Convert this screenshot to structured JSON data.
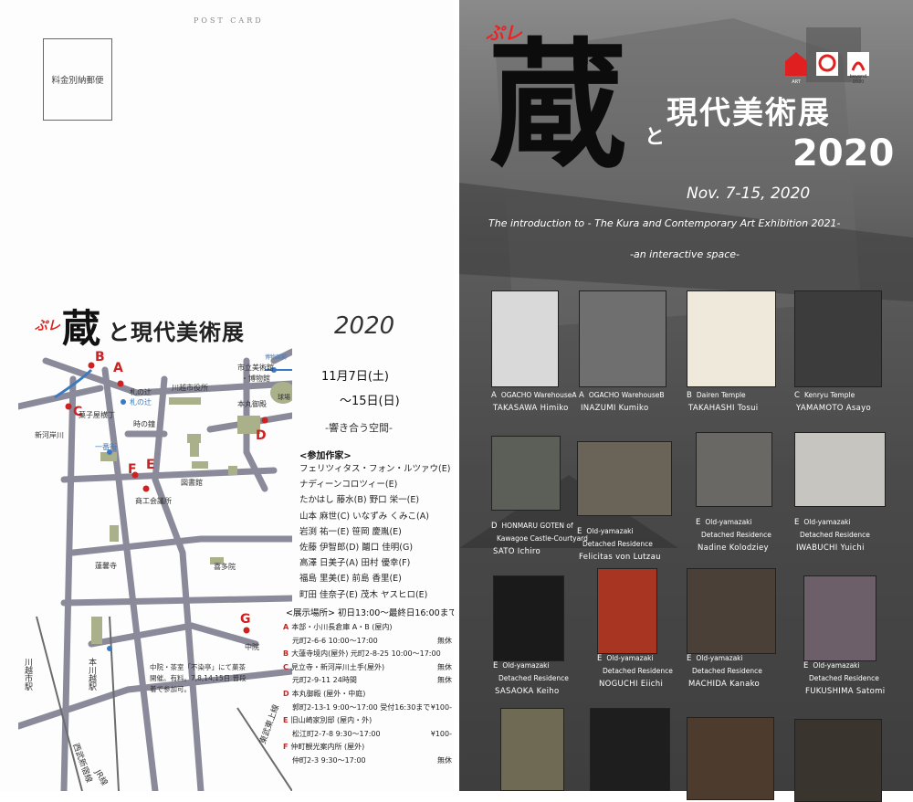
{
  "left_card": {
    "header": "POST CARD",
    "stamp": "料金別納郵便",
    "title_pre": "ぷレ",
    "title_kura": "蔵",
    "title_rest": "と現代美術展",
    "title_year": "2020",
    "date_start": "11月7日(土)",
    "date_end": "〜15日(日)",
    "subtitle": "-響き合う空間-",
    "artists_heading": "<参加作家>",
    "artists": [
      "フェリツィタス・フォン・ルツァウ(E)",
      "ナディーンコロツィー(E)",
      "たかはし 藤水(B)  野口 栄一(E)",
      "山本 麻世(C)  いなずみ くみこ(A)",
      "岩渕 祐一(E)  笹岡 慶胤(E)",
      "佐藤 伊智郎(D)  鬮口 佳明(G)",
      "高澤 日美子(A)  田村 優幸(F)",
      "福島 里美(E)  前島 香里(E)",
      "町田 佳奈子(E)  茂木 ヤスヒロ(E)"
    ],
    "venues_heading": "<展示場所>  初日13:00〜最終日16:00まで",
    "venues": [
      {
        "letter": "A",
        "text": "本部・小川長倉庫 A・B (屋内)",
        "right": ""
      },
      {
        "letter": "",
        "text": "元町2-6-6  10:00〜17:00",
        "right": "無休"
      },
      {
        "letter": "B",
        "text": "大蓮寺境内(屋外) 元町2-8-25 10:00〜17:00",
        "right": "無休"
      },
      {
        "letter": "C",
        "text": "見立寺・新河岸川土手(屋外)",
        "right": ""
      },
      {
        "letter": "",
        "text": "元町2-9-11 24時間",
        "right": "無休"
      },
      {
        "letter": "D",
        "text": "本丸御殿 (屋外・中庭)",
        "right": ""
      },
      {
        "letter": "",
        "text": "郭町2-13-1 9:00〜17:00 受付16:30まで",
        "right": "¥100-"
      },
      {
        "letter": "E",
        "text": "旧山崎家別邸 (屋内・外)",
        "right": ""
      },
      {
        "letter": "",
        "text": "松江町2-7-8  9:30〜17:00",
        "right": "¥100-"
      },
      {
        "letter": "F",
        "text": "仲町観光案内所 (屋外)",
        "right": ""
      },
      {
        "letter": "",
        "text": "仲町2-3  9:30〜17:00",
        "right": "無休"
      }
    ],
    "map_labels": {
      "a": "A",
      "b": "B",
      "c": "C",
      "d": "D",
      "e": "E",
      "f": "F",
      "g": "G",
      "fudanotsuji": "札の辻",
      "fudanotsuji2": "札の辻",
      "cityhall": "川越市役所",
      "museum": "市立美術館",
      "museum2": "・博物館",
      "honmaru": "本丸御殿",
      "kashiya": "菓子屋横丁",
      "tokinokane": "時の鐘",
      "shingashi": "新河岸川",
      "ichibangai": "一番街",
      "library": "図書館",
      "shoko": "商工会議所",
      "renjaku": "蓮馨寺",
      "kitain": "喜多院",
      "chuin": "中院",
      "hon_kawagoe": "本川越駅",
      "kawagoe_sta": "川越市駅",
      "seibu": "西武新宿線",
      "tobu": "東武東上線",
      "jr": "JR線",
      "kyujo": "球場",
      "museum_sm": "博物館前"
    },
    "notice": "中院・茶室「不染亭」にて菓茶開催。有料。7,8,14,15日  普段着で参加可。"
  },
  "right_card": {
    "pre": "ぷレ",
    "kura": "蔵",
    "to": "と",
    "main": "現代美術展",
    "year": "2020",
    "dates": "Nov. 7-15, 2020",
    "intro": "The introduction to - The Kura and Contemporary  Art  Exhibition 2021-",
    "interactive": "-an interactive space-",
    "logos": [
      {
        "icon": "house-art-icon",
        "label": "ART"
      },
      {
        "icon": "p-logo-icon",
        "label": ""
      },
      {
        "icon": "beyond-2020-icon",
        "label": "beyond 2020"
      }
    ],
    "works": [
      {
        "letter": "A",
        "venue": "OGACHO WarehouseA",
        "detail": "",
        "name": "TAKASAWA Himiko",
        "color": "#d9d9d9"
      },
      {
        "letter": "A",
        "venue": "OGACHO WarehouseB",
        "detail": "",
        "name": "INAZUMI Kumiko",
        "color": "#6f6f6f"
      },
      {
        "letter": "B",
        "venue": "Dairen Temple",
        "detail": "",
        "name": "TAKAHASHI Tosui",
        "color": "#efe9dc"
      },
      {
        "letter": "C",
        "venue": "Kenryu Temple",
        "detail": "",
        "name": "YAMAMOTO Asayo",
        "color": "#3c3c3c"
      },
      {
        "letter": "D",
        "venue": "HONMARU GOTEN of",
        "detail": "Kawagoe Castle-Courtyard",
        "name": "SATO Ichiro",
        "color": "#5b5f58"
      },
      {
        "letter": "E",
        "venue": "Old-yamazaki",
        "detail": "Detached Residence",
        "name": "Felicitas von Lutzau",
        "color": "#6a6458"
      },
      {
        "letter": "E",
        "venue": "Old-yamazaki",
        "detail": "Detached Residence",
        "name": "Nadine Kolodziey",
        "color": "#6a6864"
      },
      {
        "letter": "E",
        "venue": "Old-yamazaki",
        "detail": "Detached Residence",
        "name": "IWABUCHI Yuichi",
        "color": "#c7c5c0"
      },
      {
        "letter": "E",
        "venue": "Old-yamazaki",
        "detail": "Detached Residence",
        "name": "SASAOKA Keiho",
        "color": "#1a1a1a"
      },
      {
        "letter": "E",
        "venue": "Old-yamazaki",
        "detail": "Detached Residence",
        "name": "NOGUCHI Eiichi",
        "color": "#a83422"
      },
      {
        "letter": "E",
        "venue": "Old-yamazaki",
        "detail": "Detached Residence",
        "name": "MACHIDA Kanako",
        "color": "#4a4038"
      },
      {
        "letter": "E",
        "venue": "Old-yamazaki",
        "detail": "Detached Residence",
        "name": "FUKUSHIMA Satomi",
        "color": "#6c5f6a"
      },
      {
        "letter": "",
        "venue": "",
        "detail": "",
        "name": "",
        "color": "#6e6a54"
      },
      {
        "letter": "",
        "venue": "",
        "detail": "",
        "name": "",
        "color": "#1e1e1e"
      },
      {
        "letter": "",
        "venue": "",
        "detail": "",
        "name": "",
        "color": "#4d3c2e"
      },
      {
        "letter": "",
        "venue": "",
        "detail": "",
        "name": "",
        "color": "#3a342e"
      }
    ]
  }
}
